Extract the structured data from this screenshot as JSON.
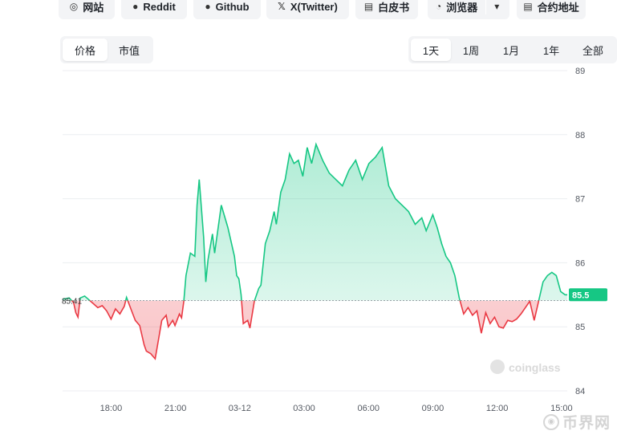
{
  "links": [
    {
      "icon": "globe-icon",
      "glyph": "◎",
      "label": "网站"
    },
    {
      "icon": "reddit-icon",
      "glyph": "●",
      "label": "Reddit"
    },
    {
      "icon": "github-icon",
      "glyph": "●",
      "label": "Github"
    },
    {
      "icon": "x-icon",
      "glyph": "𝕏",
      "label": "X(Twitter)"
    },
    {
      "icon": "document-icon",
      "glyph": "▤",
      "label": "白皮书"
    },
    {
      "icon": "explorer-icon",
      "glyph": "◔",
      "label": "浏览器"
    },
    {
      "icon": "contract-icon",
      "glyph": "▤",
      "label": "合约地址"
    }
  ],
  "metric_tabs": [
    "价格",
    "市值"
  ],
  "metric_active": 0,
  "range_tabs": [
    "1天",
    "1周",
    "1月",
    "1年",
    "全部"
  ],
  "range_active": 0,
  "watermark": "coinglass",
  "site_logo": "币界网",
  "colors": {
    "up": "#16c784",
    "down": "#ea3943",
    "grid": "#eceef1",
    "axis_text": "#555a63"
  },
  "chart_data": {
    "type": "area",
    "baseline": 85.41,
    "baseline_label": "85.41",
    "last_price": 85.5,
    "last_label": "85.5",
    "x_ticks": [
      "18:00",
      "21:00",
      "03-12",
      "03:00",
      "06:00",
      "09:00",
      "12:00",
      "15:00"
    ],
    "y_ticks": [
      84,
      85,
      86,
      87,
      88,
      89
    ],
    "ylim": [
      84,
      89
    ],
    "xlim": [
      0,
      22.9
    ],
    "y_axis": "right",
    "grid": true,
    "x": [
      0,
      0.3,
      0.5,
      0.6,
      0.7,
      0.8,
      1.0,
      1.2,
      1.4,
      1.6,
      1.8,
      2.0,
      2.2,
      2.4,
      2.6,
      2.8,
      2.9,
      3.1,
      3.3,
      3.5,
      3.7,
      3.8,
      4.0,
      4.2,
      4.4,
      4.5,
      4.7,
      4.8,
      5.0,
      5.1,
      5.3,
      5.4,
      5.5,
      5.6,
      5.8,
      6.0,
      6.1,
      6.2,
      6.4,
      6.5,
      6.6,
      6.8,
      6.9,
      7.2,
      7.5,
      7.8,
      7.9,
      8.0,
      8.1,
      8.2,
      8.4,
      8.5,
      8.7,
      8.9,
      9.0,
      9.2,
      9.4,
      9.6,
      9.7,
      9.9,
      10.1,
      10.3,
      10.5,
      10.7,
      10.9,
      11.1,
      11.3,
      11.5,
      11.8,
      12.1,
      12.4,
      12.7,
      13.0,
      13.3,
      13.6,
      13.9,
      14.2,
      14.5,
      14.8,
      15.1,
      15.4,
      15.7,
      16.0,
      16.3,
      16.5,
      16.8,
      17.0,
      17.2,
      17.4,
      17.6,
      17.8,
      18.0,
      18.2,
      18.4,
      18.6,
      18.8,
      19.0,
      19.2,
      19.4,
      19.6,
      19.8,
      20.0,
      20.2,
      20.4,
      20.6,
      20.8,
      21.0,
      21.2,
      21.4,
      21.6,
      21.8,
      22.0,
      22.2,
      22.4,
      22.6,
      22.8,
      22.9
    ],
    "y": [
      85.43,
      85.45,
      85.38,
      85.22,
      85.15,
      85.45,
      85.48,
      85.42,
      85.36,
      85.3,
      85.33,
      85.25,
      85.12,
      85.28,
      85.2,
      85.32,
      85.46,
      85.28,
      85.1,
      85.02,
      84.72,
      84.62,
      84.58,
      84.5,
      84.9,
      85.1,
      85.18,
      85.0,
      85.1,
      85.02,
      85.2,
      85.14,
      85.4,
      85.8,
      86.15,
      86.1,
      86.9,
      87.3,
      86.4,
      85.7,
      86.05,
      86.45,
      86.15,
      86.9,
      86.55,
      86.1,
      85.8,
      85.75,
      85.5,
      85.05,
      85.1,
      84.98,
      85.4,
      85.6,
      85.65,
      86.3,
      86.5,
      86.8,
      86.6,
      87.1,
      87.3,
      87.7,
      87.55,
      87.6,
      87.35,
      87.8,
      87.55,
      87.85,
      87.6,
      87.4,
      87.3,
      87.2,
      87.45,
      87.6,
      87.3,
      87.55,
      87.65,
      87.8,
      87.2,
      87.0,
      86.9,
      86.8,
      86.6,
      86.7,
      86.5,
      86.75,
      86.55,
      86.3,
      86.1,
      86.0,
      85.8,
      85.45,
      85.2,
      85.3,
      85.18,
      85.25,
      84.9,
      85.22,
      85.05,
      85.15,
      85.0,
      84.98,
      85.1,
      85.08,
      85.12,
      85.2,
      85.3,
      85.4,
      85.1,
      85.4,
      85.7,
      85.8,
      85.85,
      85.8,
      85.55,
      85.5,
      85.5
    ]
  }
}
